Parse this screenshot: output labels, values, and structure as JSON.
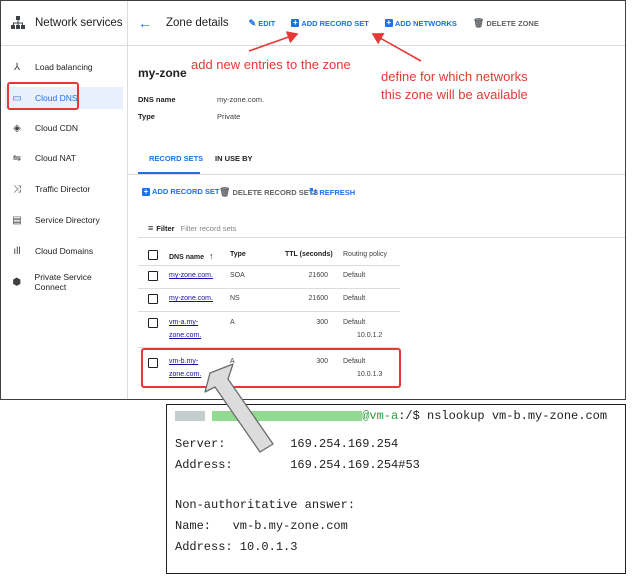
{
  "sidebar": {
    "title": "Network services",
    "items": [
      {
        "label": "Load balancing",
        "icon": "load-balancing-icon"
      },
      {
        "label": "Cloud DNS",
        "icon": "dns-icon"
      },
      {
        "label": "Cloud CDN",
        "icon": "cdn-icon"
      },
      {
        "label": "Cloud NAT",
        "icon": "nat-icon"
      },
      {
        "label": "Traffic Director",
        "icon": "traffic-director-icon"
      },
      {
        "label": "Service Directory",
        "icon": "service-directory-icon"
      },
      {
        "label": "Cloud Domains",
        "icon": "domains-icon"
      },
      {
        "label": "Private Service Connect",
        "icon": "private-service-connect-icon"
      }
    ]
  },
  "header": {
    "title": "Zone details",
    "edit": "EDIT",
    "add_record_set": "ADD RECORD SET",
    "add_networks": "ADD NETWORKS",
    "delete_zone": "DELETE ZONE"
  },
  "annotations": {
    "add_entries": "add new entries to the zone",
    "networks_line1": "define for which networks",
    "networks_line2": "this zone will be available"
  },
  "zone": {
    "name": "my-zone",
    "dns_name_label": "DNS name",
    "dns_name_value": "my-zone.com.",
    "type_label": "Type",
    "type_value": "Private"
  },
  "tabs": {
    "record_sets": "RECORD SETS",
    "in_use_by": "IN USE BY"
  },
  "table_actions": {
    "add_record_set": "ADD RECORD SET",
    "delete_record_sets": "DELETE RECORD SETS",
    "refresh": "REFRESH"
  },
  "filter": {
    "label": "Filter",
    "placeholder": "Filter record sets"
  },
  "table": {
    "columns": [
      "DNS name",
      "Type",
      "TTL (seconds)",
      "Routing policy"
    ],
    "rows": [
      {
        "name_1": "my-zone.com.",
        "name_2": "",
        "type": "SOA",
        "ttl": "21600",
        "policy": "Default",
        "data": ""
      },
      {
        "name_1": "my-zone.com.",
        "name_2": "",
        "type": "NS",
        "ttl": "21600",
        "policy": "Default",
        "data": ""
      },
      {
        "name_1": "vm-a.my-",
        "name_2": "zone.com.",
        "type": "A",
        "ttl": "300",
        "policy": "Default",
        "data": "10.0.1.2"
      },
      {
        "name_1": "vm-b.my-",
        "name_2": "zone.com.",
        "type": "A",
        "ttl": "300",
        "policy": "Default",
        "data": "10.0.1.3"
      }
    ]
  },
  "terminal": {
    "prompt_host": "@vm-a",
    "command": ":/$ nslookup vm-b.my-zone.com",
    "server": "Server:         169.254.169.254",
    "address": "Address:        169.254.169.254#53",
    "non_auth": "Non-authoritative answer:",
    "name": "Name:   vm-b.my-zone.com",
    "answer_address": "Address: 10.0.1.3"
  },
  "colors": {
    "accent": "#1a73e8",
    "annotation": "#e53935",
    "prompt": "#2e9d3e"
  }
}
